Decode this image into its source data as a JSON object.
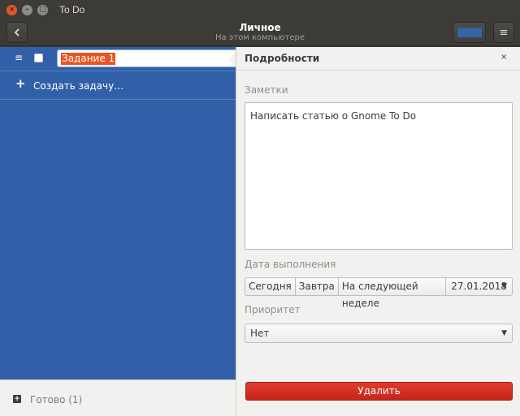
{
  "window": {
    "title": "To Do"
  },
  "header": {
    "title": "Личное",
    "subtitle": "На этом компьютере",
    "list_color": "#3465a4"
  },
  "task": {
    "name": "Задание 1",
    "completed": false
  },
  "new_task": {
    "label": "Создать задачу…"
  },
  "footer": {
    "done_label": "Готово (1)"
  },
  "details": {
    "title": "Подробности",
    "close": "×",
    "notes_label": "Заметки",
    "notes_text": "Написать статью о Gnome To Do",
    "due_label": "Дата выполнения",
    "today": "Сегодня",
    "tomorrow": "Завтра",
    "next_week": "На следующей неделе",
    "date_value": "27.01.2018",
    "priority_label": "Приоритет",
    "priority_value": "Нет",
    "delete_label": "Удалить"
  },
  "colors": {
    "accent": "#3160a8",
    "selection": "#e95420",
    "destructive": "#e03b2f"
  }
}
